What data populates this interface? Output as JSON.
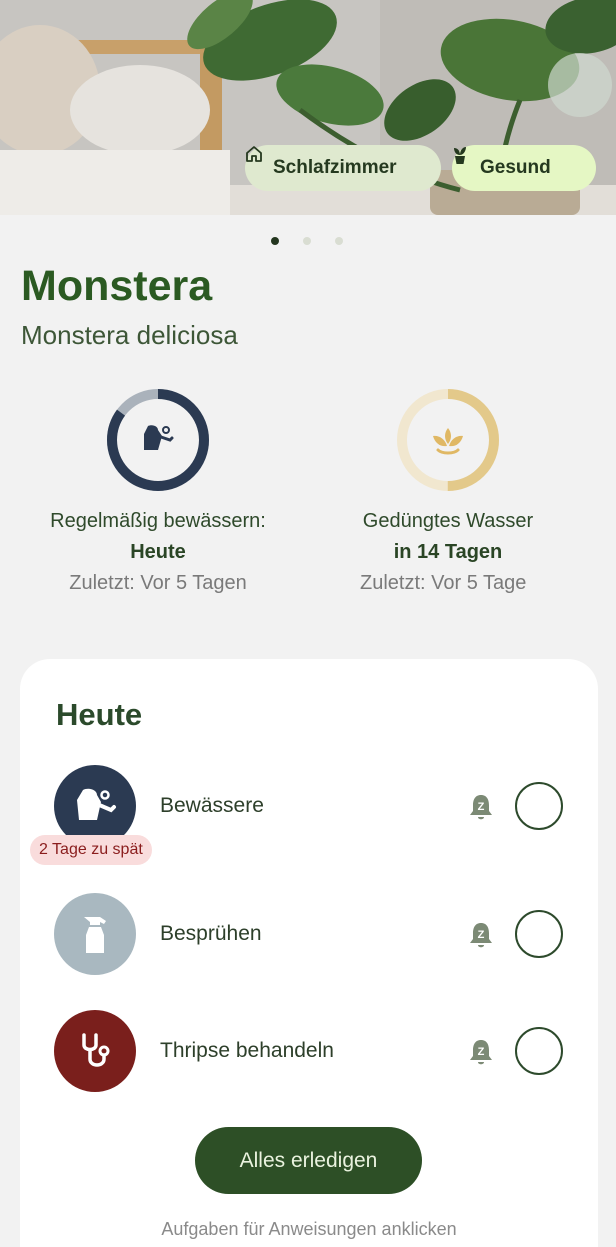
{
  "hero": {
    "room_chip": {
      "label": "Schlafzimmer",
      "icon": "home-icon"
    },
    "health_chip": {
      "label": "Gesund",
      "icon": "potted-plant-icon"
    },
    "page_indicator": {
      "count": 3,
      "active_index": 0
    }
  },
  "plant": {
    "name": "Monstera",
    "latin": "Monstera deliciosa"
  },
  "stats": [
    {
      "title": "Regelmäßig bewässern:",
      "when": "Heute",
      "last": "Zuletzt: Vor 5 Tagen",
      "icon": "watering-can-icon",
      "progress": 0.85,
      "ring_color": "#2b3a52",
      "ring_track": "#aab2bb"
    },
    {
      "title": "Gedüngtes Wasser",
      "when": "in 14 Tagen",
      "last": "Zuletzt: Vor 5 Tage",
      "icon": "sprout-icon",
      "progress": 0.5,
      "ring_color": "#e3c98a",
      "ring_track": "#f1e7cf"
    }
  ],
  "today": {
    "title": "Heute",
    "tasks": [
      {
        "label": "Bewässere",
        "icon": "watering-can-icon",
        "color": "#2b3a52",
        "badge": "2 Tage zu spät"
      },
      {
        "label": "Besprühen",
        "icon": "spray-bottle-icon",
        "color": "#a9b8c0",
        "badge": ""
      },
      {
        "label": "Thripse behandeln",
        "icon": "stethoscope-icon",
        "color": "#7a1f1c",
        "badge": ""
      }
    ],
    "complete_all_label": "Alles erledigen",
    "hint": "Aufgaben für Anweisungen anklicken"
  }
}
